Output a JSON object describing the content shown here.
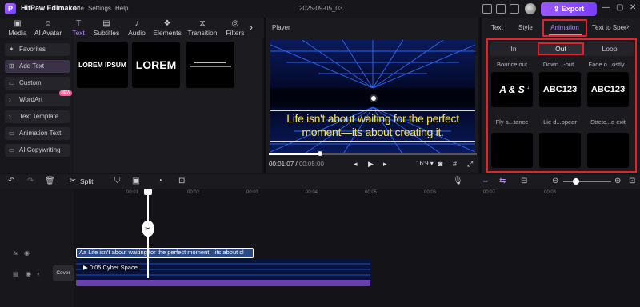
{
  "app": {
    "name": "HitPaw Edimakor",
    "menu": [
      "File",
      "Settings",
      "Help"
    ],
    "project_title": "2025-09-05_03",
    "export_label": "Export"
  },
  "media_tabs": [
    {
      "label": "Media",
      "icon": "media-icon"
    },
    {
      "label": "AI Avatar",
      "icon": "ai-avatar-icon"
    },
    {
      "label": "Text",
      "icon": "text-icon",
      "active": true
    },
    {
      "label": "Subtitles",
      "icon": "subtitles-icon"
    },
    {
      "label": "Audio",
      "icon": "audio-icon"
    },
    {
      "label": "Elements",
      "icon": "elements-icon"
    },
    {
      "label": "Transition",
      "icon": "transition-icon"
    },
    {
      "label": "Filters",
      "icon": "filters-icon"
    }
  ],
  "sidebar": {
    "items": [
      {
        "label": "Favorites"
      },
      {
        "label": "Add Text",
        "active": true
      },
      {
        "label": "Custom"
      },
      {
        "label": "WordArt",
        "badge": "NEW"
      },
      {
        "label": "Text Template"
      },
      {
        "label": "Animation Text"
      },
      {
        "label": "AI Copywriting"
      }
    ]
  },
  "library": {
    "templates": [
      "LOREM IPSUM",
      "LOREM",
      ""
    ]
  },
  "player": {
    "title": "Player",
    "caption_line1": "Life isn't about waiting for the perfect",
    "caption_line2": "moment—its about creating it.",
    "current_time": "00:01:07",
    "total_time": "00:05:00",
    "aspect": "16:9",
    "progress": 0.22
  },
  "right_panel": {
    "tabs": [
      "Text",
      "Style",
      "Animation",
      "Text to Speech"
    ],
    "active_tab": "Animation",
    "sub_tabs": [
      "In",
      "Out",
      "Loop"
    ],
    "active_sub_tab": "Out",
    "row_labels_top": [
      "Bounce out",
      "Down...-out",
      "Fade o...ostly"
    ],
    "cards": [
      "A & S",
      "ABC123",
      "ABC123"
    ],
    "card_labels": [
      "Fly a...tance",
      "Lie d...ppear",
      "Stretc...d exit"
    ]
  },
  "timeline": {
    "split_label": "Split",
    "ruler": [
      "00:01",
      "00:02",
      "00:03",
      "00:04",
      "00:05",
      "00:06",
      "00:07",
      "00:08"
    ],
    "text_clip": "Aa Life isn't about waiting for the perfect moment—its about cl",
    "video_clip": "0:05 Cyber Space",
    "cover_label": "Cover"
  }
}
